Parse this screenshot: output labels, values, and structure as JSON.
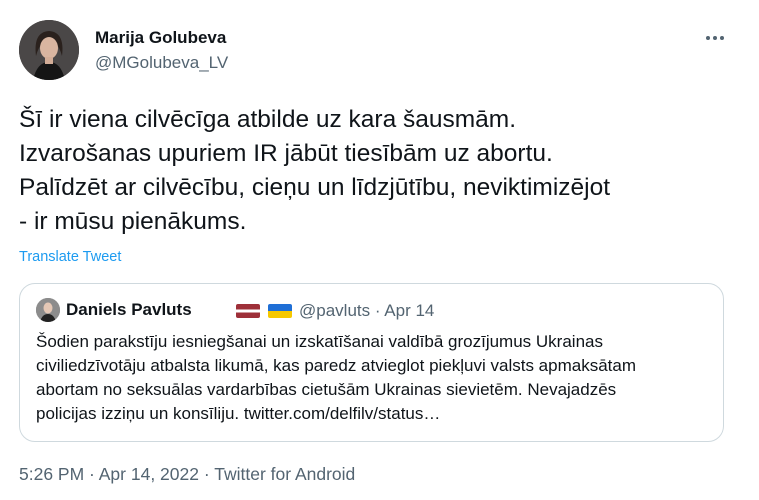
{
  "author": {
    "name": "Marija Golubeva",
    "handle": "@MGolubeva_LV",
    "avatar_icon": "profile-photo"
  },
  "menu": {
    "icon": "more-horizontal-icon"
  },
  "tweet": {
    "lines": [
      "Šī ir viena cilvēcīga atbilde uz kara šausmām.",
      "Izvarošanas upuriem IR jābūt tiesībām uz abortu.",
      "Palīdzēt ar cilvēcību, cieņu un līdzjūtību, neviktimizējot",
      "- ir mūsu pienākums."
    ],
    "translate_label": "Translate Tweet"
  },
  "quote": {
    "name": "Daniels Pavluts",
    "flags": [
      "latvia-flag",
      "ukraine-flag"
    ],
    "handle_date": "@pavluts · Apr 14",
    "lines": [
      "Šodien parakstīju iesniegšanai un izskatīšanai valdībā grozījumus Ukrainas",
      "civiliedzīvotāju atbalsta likumā, kas paredz atvieglot piekļuvi valsts apmaksātam",
      "abortam no seksuālas vardarbības cietušām Ukrainas sievietēm. Nevajadzēs",
      "policijas izziņu un konsīliju. twitter.com/delfilv/status…"
    ]
  },
  "meta": {
    "time_date": "5:26 PM · Apr 14, 2022",
    "separator": " · ",
    "source": "Twitter for Android"
  },
  "colors": {
    "text": "#0f1419",
    "secondary": "#536471",
    "link": "#1d9bf0",
    "border": "#cfd9de"
  }
}
